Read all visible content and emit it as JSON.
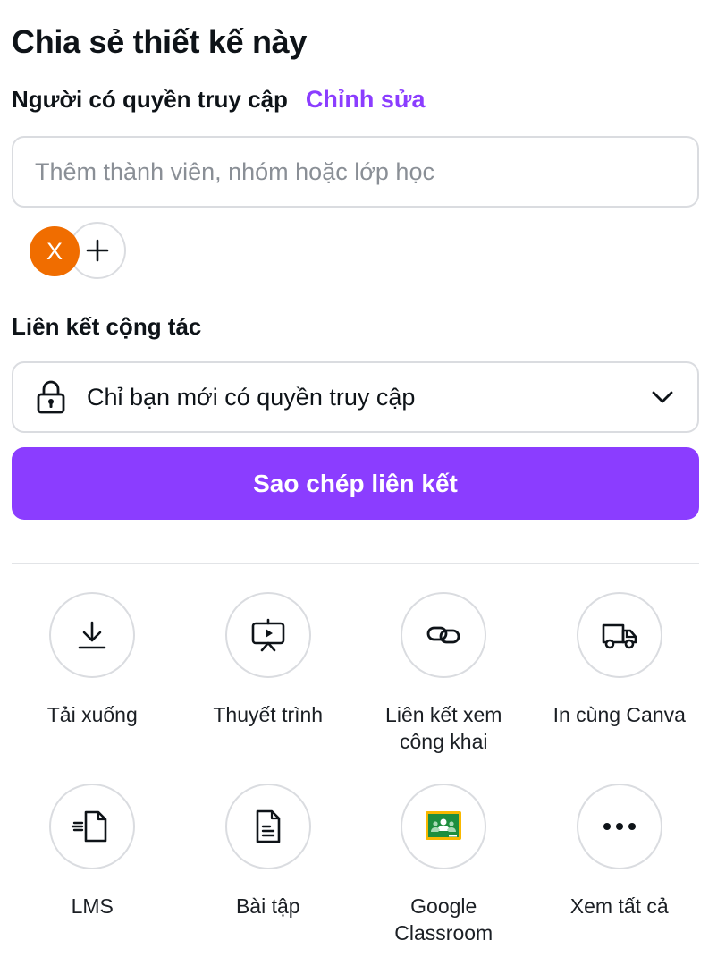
{
  "dialog": {
    "title": "Chia sẻ thiết kế này",
    "access_label": "Người có quyền truy cập",
    "edit_link": "Chỉnh sửa",
    "member_input": {
      "placeholder": "Thêm thành viên, nhóm hoặc lớp học",
      "value": ""
    },
    "avatar_initial": "X",
    "collab_label": "Liên kết cộng tác",
    "access_select": {
      "value": "Chỉ bạn mới có quyền truy cập",
      "icon": "lock-icon"
    },
    "copy_button": "Sao chép liên kết"
  },
  "colors": {
    "accent": "#8b3dff",
    "avatar": "#f06d00"
  },
  "options": [
    {
      "label": "Tải xuống",
      "icon": "download-icon"
    },
    {
      "label": "Thuyết trình",
      "icon": "present-icon"
    },
    {
      "label": "Liên kết xem công khai",
      "icon": "link-icon"
    },
    {
      "label": "In cùng Canva",
      "icon": "truck-icon"
    },
    {
      "label": "LMS",
      "icon": "lms-icon"
    },
    {
      "label": "Bài tập",
      "icon": "assignment-icon"
    },
    {
      "label": "Google Classroom",
      "icon": "google-classroom-icon"
    },
    {
      "label": "Xem tất cả",
      "icon": "more-icon"
    }
  ]
}
